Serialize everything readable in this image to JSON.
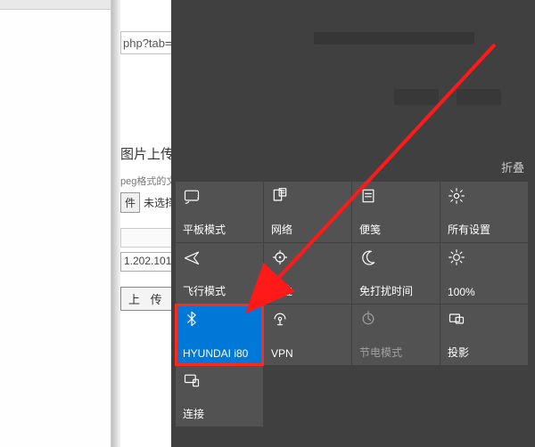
{
  "mid": {
    "addr_fragment": "php?tab=",
    "section_title": "图片上传",
    "format_hint": "peg格式的文",
    "file_btn": "件",
    "file_status": "未选择",
    "ip_value": "1.202.101",
    "upload_label": "上 传"
  },
  "panel": {
    "collapse_label": "折叠",
    "tiles": [
      {
        "id": "tablet-mode",
        "icon": "tablet",
        "label": "平板模式",
        "dim": false
      },
      {
        "id": "network",
        "icon": "network",
        "label": "网络",
        "dim": false
      },
      {
        "id": "note",
        "icon": "note",
        "label": "便笺",
        "dim": false
      },
      {
        "id": "all-settings",
        "icon": "gear",
        "label": "所有设置",
        "dim": false
      },
      {
        "id": "airplane",
        "icon": "airplane",
        "label": "飞行模式",
        "dim": false
      },
      {
        "id": "location",
        "icon": "location",
        "label": "定位",
        "dim": false
      },
      {
        "id": "quiet-hours",
        "icon": "moon",
        "label": "免打扰时间",
        "dim": false
      },
      {
        "id": "brightness",
        "icon": "sun",
        "label": "100%",
        "dim": false
      },
      {
        "id": "bluetooth",
        "icon": "bluetooth",
        "label": "HYUNDAI i80",
        "dim": false,
        "highlight": true
      },
      {
        "id": "vpn",
        "icon": "vpn",
        "label": "VPN",
        "dim": false
      },
      {
        "id": "battery",
        "icon": "battery",
        "label": "节电模式",
        "dim": true
      },
      {
        "id": "project",
        "icon": "project",
        "label": "投影",
        "dim": false
      },
      {
        "id": "connect",
        "icon": "connect",
        "label": "连接",
        "dim": false,
        "extraRow": true
      }
    ]
  }
}
